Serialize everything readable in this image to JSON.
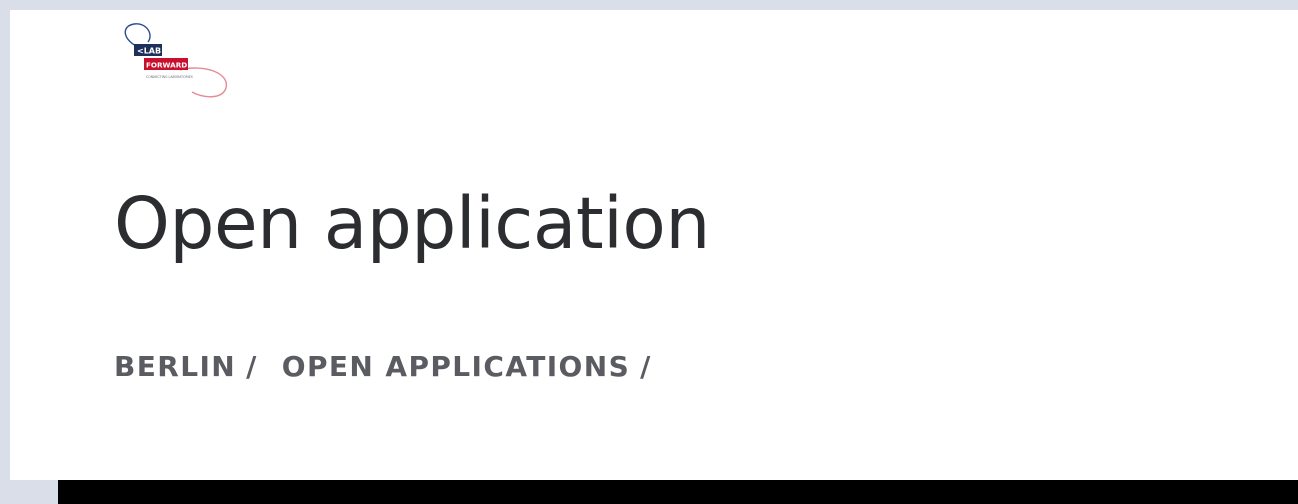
{
  "header": {
    "logo": {
      "line1": "<LAB",
      "line2": "FORWARD>",
      "tagline": "CONNECTING LABORATORIES",
      "colors": {
        "navy": "#1f2f5c",
        "red": "#c8102e",
        "pink_outline": "#e58a96",
        "blue_outline": "#2a4d8f"
      }
    }
  },
  "main": {
    "title": "Open application",
    "breadcrumb": {
      "items": [
        {
          "label": "BERLIN",
          "separator": "/"
        },
        {
          "label": "OPEN APPLICATIONS",
          "separator": "/"
        }
      ]
    }
  },
  "colors": {
    "page_background": "#ffffff",
    "outer_background": "#d9dee8",
    "title_text": "#2b2d31",
    "breadcrumb_text": "#5a5c61",
    "footer_bar": "#000000"
  }
}
